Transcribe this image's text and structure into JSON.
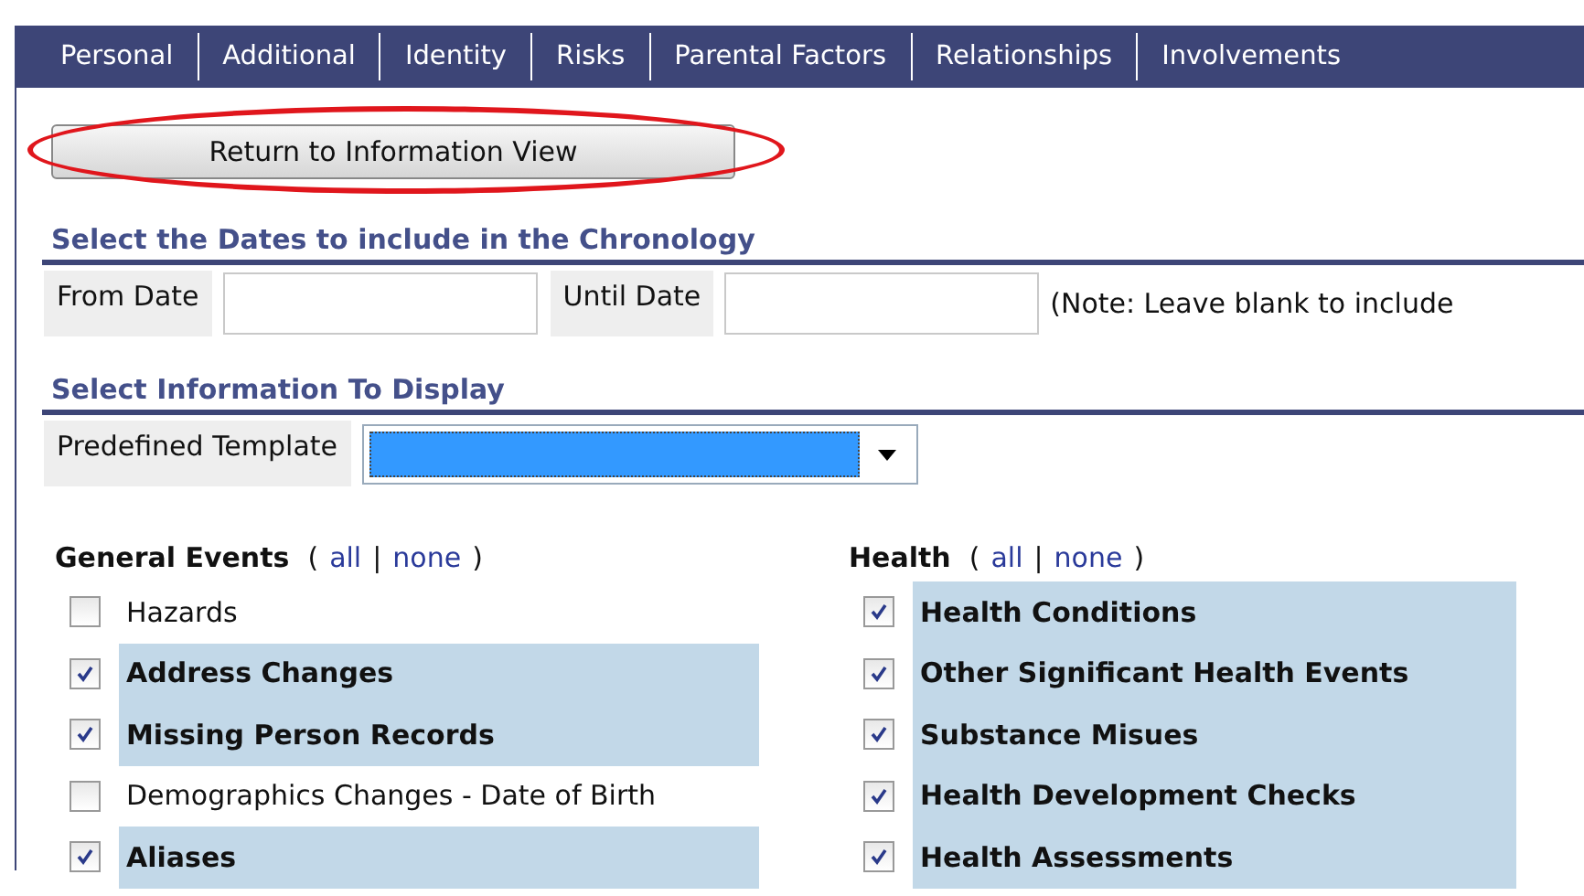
{
  "tabs": [
    {
      "label": "Personal"
    },
    {
      "label": "Additional"
    },
    {
      "label": "Identity"
    },
    {
      "label": "Risks"
    },
    {
      "label": "Parental Factors"
    },
    {
      "label": "Relationships"
    },
    {
      "label": "Involvements"
    }
  ],
  "return_button": {
    "label": "Return to Information View",
    "highlighted": true
  },
  "dates_section": {
    "heading": "Select the Dates to include in the Chronology",
    "from_label": "From Date",
    "until_label": "Until Date",
    "note": "(Note: Leave blank to include"
  },
  "display_section": {
    "heading": "Select Information To Display",
    "template_label": "Predefined Template"
  },
  "groups": [
    {
      "title": "General Events",
      "open_paren": "(",
      "all": "all",
      "separator": "|",
      "none": "none",
      "close_paren": ")",
      "items": [
        {
          "label": "Hazards",
          "checked": false
        },
        {
          "label": "Address Changes",
          "checked": true
        },
        {
          "label": "Missing Person Records",
          "checked": true
        },
        {
          "label": "Demographics Changes - Date of Birth",
          "checked": false
        },
        {
          "label": "Aliases",
          "checked": true
        }
      ]
    },
    {
      "title": "Health",
      "open_paren": "(",
      "all": "all",
      "separator": "|",
      "none": "none",
      "close_paren": ")",
      "items": [
        {
          "label": "Health Conditions",
          "checked": true
        },
        {
          "label": "Other Significant Health Events",
          "checked": true
        },
        {
          "label": "Substance Misues",
          "checked": true
        },
        {
          "label": "Health Development Checks",
          "checked": true
        },
        {
          "label": "Health Assessments",
          "checked": true
        }
      ]
    }
  ]
}
